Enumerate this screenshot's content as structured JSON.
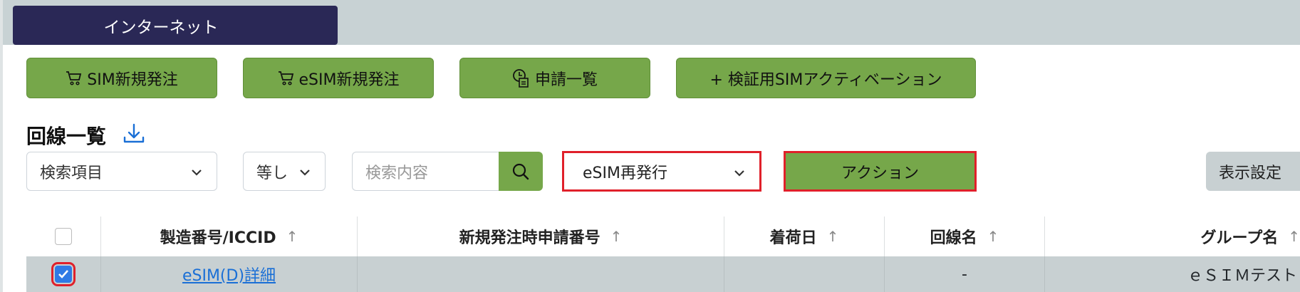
{
  "tab": {
    "label": "インターネット"
  },
  "toolbar": {
    "buttons": [
      {
        "label": "SIM新規発注",
        "icon": "cart-icon"
      },
      {
        "label": "eSIM新規発注",
        "icon": "cart-icon"
      },
      {
        "label": "申請一覧",
        "icon": "clipboard-clock-icon"
      },
      {
        "label": "+ 検証用SIMアクティベーション",
        "icon": ""
      }
    ]
  },
  "section": {
    "title": "回線一覧",
    "download_icon": "download-icon"
  },
  "filters": {
    "search_field": "検索項目",
    "operator": "等し",
    "search_placeholder": "検索内容",
    "action_select": "eSIM再発行",
    "action_button": "アクション",
    "display_settings": "表示設定"
  },
  "table": {
    "columns": [
      {
        "label": ""
      },
      {
        "label": "製造番号/ICCID"
      },
      {
        "label": "新規発注時申請番号"
      },
      {
        "label": "着荷日"
      },
      {
        "label": "回線名"
      },
      {
        "label": "グループ名"
      }
    ],
    "rows": [
      {
        "checked": true,
        "iccid": "eSIM(D)詳細",
        "order_no": "",
        "arrival": "",
        "line_name": "-",
        "group": "ｅＳＩＭテスト"
      }
    ]
  },
  "colors": {
    "green": "#76a74a",
    "navy": "#2a2856",
    "highlight": "#e0202a",
    "link": "#1a6fd6"
  }
}
